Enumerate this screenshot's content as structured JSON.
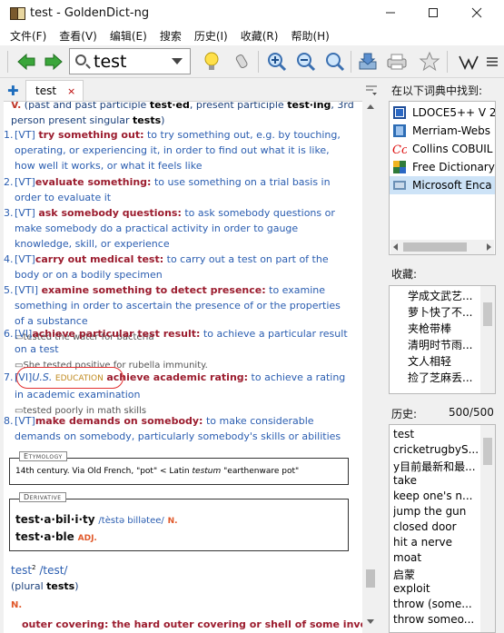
{
  "window": {
    "title": "test - GoldenDict-ng"
  },
  "menu": [
    "文件(F)",
    "查看(V)",
    "编辑(E)",
    "搜索",
    "历史(I)",
    "收藏(R)",
    "帮助(H)"
  ],
  "search": {
    "value": "test"
  },
  "tab": {
    "label": "test",
    "close": "×"
  },
  "article": {
    "intro_pos": "V.",
    "intro_text": "(past and past participle",
    "intro_f1": "test·ed",
    "intro_mid": ", present participle",
    "intro_f2": "test·ing",
    "intro_end": ", 3rd person present singular",
    "intro_f3": "tests",
    "intro_close": ")",
    "senses": [
      {
        "num": "1.",
        "gram": "[VT]",
        "kw": "try something out:",
        "def": "to try something out, e.g. by touching, operating, or experiencing it, in order to find out what it is like, how well it works, or what it feels like",
        "ex": ""
      },
      {
        "num": "2.",
        "gram": "[VT]",
        "kw": "evaluate something:",
        "def": "to use something on a trial basis in order to evaluate it",
        "ex": ""
      },
      {
        "num": "3.",
        "gram": "[VT]",
        "kw": "ask somebody questions:",
        "def": "to ask somebody questions or make somebody do a practical activity in order to gauge knowledge, skill, or experience",
        "ex": ""
      },
      {
        "num": "4.",
        "gram": "[VT]",
        "kw": "carry out medical test:",
        "def": "to carry out a test on part of the body or on a bodily specimen",
        "ex": ""
      },
      {
        "num": "5.",
        "gram": "[VTI]",
        "kw": "examine something to detect presence:",
        "def": "to examine something in order to ascertain the presence of or the properties of a substance",
        "ex": "tested the water for bacteria"
      },
      {
        "num": "6.",
        "gram": "[VI]",
        "kw": "achieve particular test result:",
        "def": "to achieve a particular result on a test",
        "ex": "She tested positive for rubella immunity."
      },
      {
        "num": "7.",
        "gram": "[VI]",
        "region": "U.S.",
        "field": "EDUCATION",
        "kw": "achieve academic rating:",
        "def": "to achieve a rating in academic examination",
        "ex": "tested poorly in math skills"
      },
      {
        "num": "8.",
        "gram": "[VT]",
        "kw": "make demands on somebody:",
        "def": "to make considerable demands on somebody, particularly somebody's skills or abilities",
        "ex": ""
      }
    ],
    "etymology_label": "Etymology",
    "etymology_text": "14th century. Via Old French, \"pot\" < Latin",
    "etymology_word": "testum",
    "etymology_gloss": "\"earthenware pot\"",
    "derivative_label": "Derivative",
    "derivatives": [
      {
        "word": "test·a·bil·i·ty",
        "pron": "/tèstə billətee/",
        "pos": "N."
      },
      {
        "word": "test·a·ble",
        "pron": "",
        "pos": "ADJ."
      }
    ],
    "entry2_word": "test",
    "entry2_sup": "2",
    "entry2_pron": "/test/",
    "entry2_plural": "(plural",
    "entry2_plural_word": "tests",
    "entry2_plural_close": ")",
    "entry2_pos": "N.",
    "entry2_cut": "outer covering: the hard outer covering or shell of some invertebrates"
  },
  "right_pane": {
    "dicts_label": "在以下词典中找到:",
    "dicts": [
      "LDOCE5++ V 2",
      "Merriam-Webs",
      "Collins COBUIL",
      "Free Dictionary",
      "Microsoft Enca"
    ],
    "favorites_label": "收藏:",
    "favorites": [
      "学成文武艺...",
      "萝卜快了不...",
      "夹枪带棒",
      "清明时节雨...",
      "文人相轻",
      "捡了芝麻丢..."
    ],
    "history_label": "历史:",
    "history_count": "500/500",
    "history": [
      "test",
      "cricketrugbyS...",
      "y目前最新和最...",
      "take",
      "keep one's n...",
      "jump the gun",
      "closed door",
      "hit a nerve",
      "moat",
      "启蒙",
      "exploit",
      "throw (some...",
      "throw someo..."
    ]
  }
}
